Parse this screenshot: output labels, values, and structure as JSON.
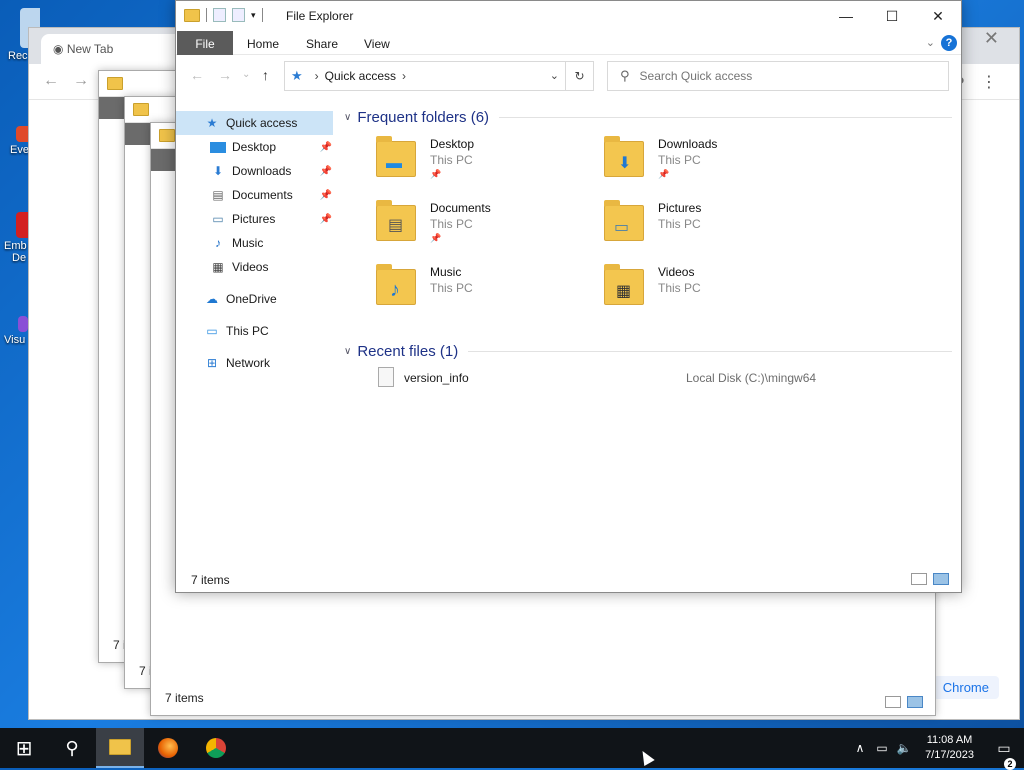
{
  "desktop": {
    "icons": [
      {
        "label": "Rec",
        "icon": "recycle-bin-icon",
        "color": "#bcd6ee"
      },
      {
        "label": "Eve",
        "icon": "event-viewer-icon",
        "color": "#e04a2a"
      },
      {
        "label": "Emb",
        "label2": "De",
        "icon": "app-icon",
        "color": "#d32020"
      },
      {
        "label": "Visu",
        "icon": "visual-studio-icon",
        "color": "#8a4fd6"
      }
    ]
  },
  "chrome": {
    "tab_title": "New Tab",
    "close": "✕",
    "link_text": "Chrome"
  },
  "ghost_windows": [
    {
      "status": "7 i"
    },
    {
      "status": "7 i"
    },
    {
      "status": "7 items"
    }
  ],
  "explorer": {
    "title": "File Explorer",
    "ribbon": {
      "file": "File",
      "home": "Home",
      "share": "Share",
      "view": "View",
      "help": "?"
    },
    "address": {
      "crumb": "Quick access"
    },
    "search": {
      "placeholder": "Search Quick access"
    },
    "nav": [
      {
        "label": "Quick access",
        "icon": "quick-access-star-icon",
        "glyph": "★",
        "color": "#2b7cd3",
        "selected": true
      },
      {
        "label": "Desktop",
        "icon": "desktop-icon",
        "glyph": "▬",
        "color": "#2a8de0",
        "pinned": true
      },
      {
        "label": "Downloads",
        "icon": "downloads-icon",
        "glyph": "⬇",
        "color": "#2b7cd3",
        "pinned": true
      },
      {
        "label": "Documents",
        "icon": "documents-icon",
        "glyph": "▤",
        "color": "#666",
        "pinned": true
      },
      {
        "label": "Pictures",
        "icon": "pictures-icon",
        "glyph": "▭",
        "color": "#4a7fa8",
        "pinned": true
      },
      {
        "label": "Music",
        "icon": "music-icon",
        "glyph": "♪",
        "color": "#1f6fc7"
      },
      {
        "label": "Videos",
        "icon": "videos-icon",
        "glyph": "▦",
        "color": "#444"
      },
      {
        "label": "OneDrive",
        "icon": "onedrive-icon",
        "glyph": "☁",
        "color": "#1f78d1"
      },
      {
        "label": "This PC",
        "icon": "this-pc-icon",
        "glyph": "▭",
        "color": "#2a8de0"
      },
      {
        "label": "Network",
        "icon": "network-icon",
        "glyph": "⊞",
        "color": "#2b7cd3"
      }
    ],
    "frequent_header": "Frequent folders (6)",
    "frequent": [
      {
        "name": "Desktop",
        "location": "This PC",
        "pinned": true,
        "overlay": "▬",
        "overlay_color": "#1f8ae0"
      },
      {
        "name": "Downloads",
        "location": "This PC",
        "pinned": true,
        "overlay": "⬇",
        "overlay_color": "#1f78d1"
      },
      {
        "name": "Documents",
        "location": "This PC",
        "pinned": true,
        "overlay": "▤",
        "overlay_color": "#555"
      },
      {
        "name": "Pictures",
        "location": "This PC",
        "pinned": false,
        "overlay": "▭",
        "overlay_color": "#4a7fa8"
      },
      {
        "name": "Music",
        "location": "This PC",
        "pinned": false,
        "overlay": "♪",
        "overlay_color": "#1f78d1"
      },
      {
        "name": "Videos",
        "location": "This PC",
        "pinned": false,
        "overlay": "▦",
        "overlay_color": "#333"
      }
    ],
    "recent_header": "Recent files (1)",
    "recent": [
      {
        "name": "version_info",
        "path": "Local Disk (C:)\\mingw64"
      }
    ],
    "status": "7 items"
  },
  "taskbar": {
    "time": "11:08 AM",
    "date": "7/17/2023",
    "notifications": "2"
  }
}
